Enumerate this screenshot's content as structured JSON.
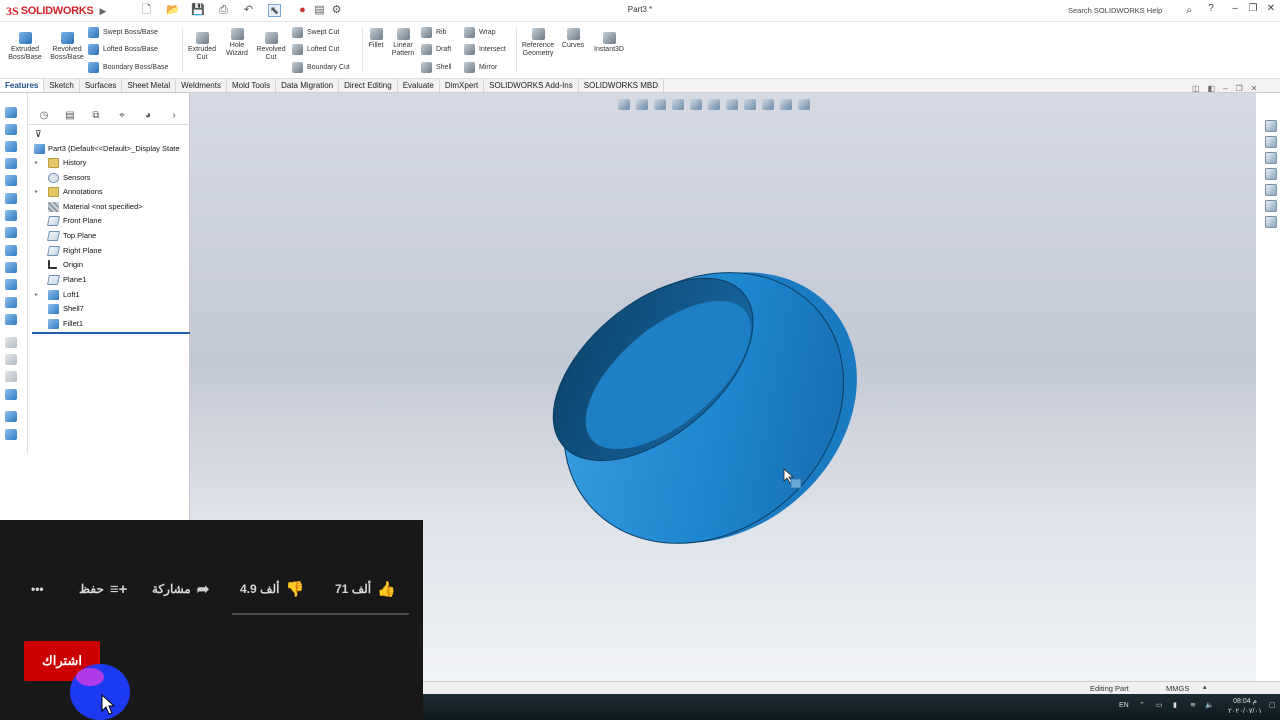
{
  "app": {
    "brand": "SOLIDWORKS",
    "doc_title": "Part3 *",
    "help_search_placeholder": "Search SOLIDWORKS Help",
    "help_icon": "?"
  },
  "ribbon": {
    "extruded_boss": "Extruded\nBoss/Base",
    "revolved_boss": "Revolved\nBoss/Base",
    "swept_boss": "Swept Boss/Base",
    "lofted_boss": "Lofted Boss/Base",
    "boundary_boss": "Boundary Boss/Base",
    "extruded_cut": "Extruded\nCut",
    "hole_wizard": "Hole\nWizard",
    "revolved_cut": "Revolved\nCut",
    "swept_cut": "Swept Cut",
    "lofted_cut": "Lofted Cut",
    "boundary_cut": "Boundary Cut",
    "fillet": "Fillet",
    "linear_pattern": "Linear\nPattern",
    "rib": "Rib",
    "draft": "Draft",
    "shell": "Shell",
    "wrap": "Wrap",
    "intersect": "Intersect",
    "mirror": "Mirror",
    "reference_geometry": "Reference\nGeometry",
    "curves": "Curves",
    "instant3d": "Instant3D"
  },
  "tabs": [
    "Features",
    "Sketch",
    "Surfaces",
    "Sheet Metal",
    "Weldments",
    "Mold Tools",
    "Data Migration",
    "Direct Editing",
    "Evaluate",
    "DimXpert",
    "SOLIDWORKS Add-Ins",
    "SOLIDWORKS MBD"
  ],
  "active_tab": "Features",
  "tree": {
    "root": "Part3  (Default<<Default>_Display State",
    "items": [
      {
        "label": "History",
        "icon": "folder",
        "expandable": true
      },
      {
        "label": "Sensors",
        "icon": "sensor",
        "expandable": false
      },
      {
        "label": "Annotations",
        "icon": "folder",
        "expandable": true
      },
      {
        "label": "Material <not specified>",
        "icon": "mat",
        "expandable": false
      },
      {
        "label": "Front Plane",
        "icon": "plane",
        "expandable": false
      },
      {
        "label": "Top Plane",
        "icon": "plane",
        "expandable": false
      },
      {
        "label": "Right Plane",
        "icon": "plane",
        "expandable": false
      },
      {
        "label": "Origin",
        "icon": "origin",
        "expandable": false
      },
      {
        "label": "Plane1",
        "icon": "plane",
        "expandable": false
      },
      {
        "label": "Loft1",
        "icon": "feat",
        "expandable": true
      },
      {
        "label": "Shell7",
        "icon": "feat",
        "expandable": false
      },
      {
        "label": "Fillet1",
        "icon": "feat",
        "expandable": false
      }
    ]
  },
  "colors": {
    "model_blue": "#1e86cf",
    "model_dark": "#0f4f7e",
    "accent_red": "#cc0000"
  },
  "youtube": {
    "likes": "71 ألف",
    "dislikes": "4.9 ألف",
    "share": "مشاركة",
    "save": "حفظ",
    "more": "•••",
    "subscribe": "اشتراك"
  },
  "status": {
    "mode": "Editing Part",
    "units": "MMGS"
  },
  "taskbar": {
    "lang": "EN",
    "time": "08:04 م",
    "date": "٢٠٢٠/٠٧/٠١"
  }
}
